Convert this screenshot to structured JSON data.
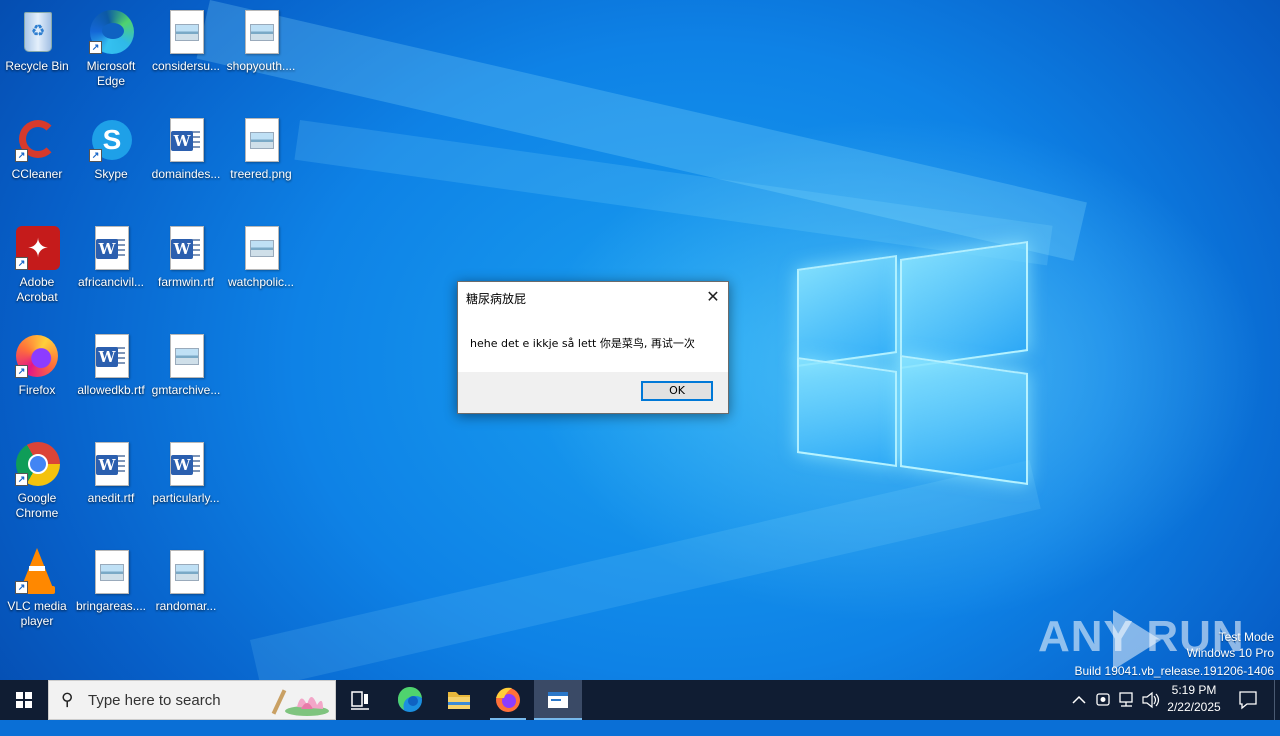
{
  "desktop": {
    "icons": [
      {
        "label": "Recycle Bin"
      },
      {
        "label": "Microsoft Edge"
      },
      {
        "label": "considersu..."
      },
      {
        "label": "shopyouth...."
      },
      {
        "label": "CCleaner"
      },
      {
        "label": "Skype"
      },
      {
        "label": "domaindes..."
      },
      {
        "label": "treered.png"
      },
      {
        "label": "Adobe Acrobat"
      },
      {
        "label": "africancivil..."
      },
      {
        "label": "farmwin.rtf"
      },
      {
        "label": "watchpolic..."
      },
      {
        "label": "Firefox"
      },
      {
        "label": "allowedkb.rtf"
      },
      {
        "label": "gmtarchive..."
      },
      {
        "label": "Google Chrome"
      },
      {
        "label": "anedit.rtf"
      },
      {
        "label": "particularly..."
      },
      {
        "label": "VLC media player"
      },
      {
        "label": "bringareas...."
      },
      {
        "label": "randomar..."
      }
    ]
  },
  "dialog": {
    "title": "糖尿病放屁",
    "message": "hehe det e ikkje så lett 你是菜鸟, 再试一次",
    "ok_label": "OK",
    "close_glyph": "✕"
  },
  "watermark": {
    "brand": "ANY RUN",
    "mode": "Test Mode",
    "edition": "Windows 10 Pro",
    "build": "Build 19041.vb_release.191206-1406"
  },
  "taskbar": {
    "search_placeholder": "Type here to search",
    "time": "5:19 PM",
    "date": "2/22/2025"
  },
  "colors": {
    "accent": "#0078d7",
    "taskbar": "#101d33",
    "desktop": "#0e82e6"
  }
}
